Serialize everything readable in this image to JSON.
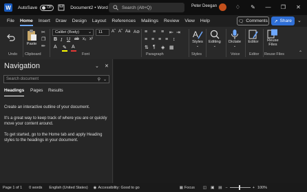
{
  "titlebar": {
    "app_letter": "W",
    "autosave_label": "AutoSave",
    "autosave_state": "Off",
    "doc_title": "Document2 • Word",
    "search_placeholder": "Search (Alt+Q)",
    "user_name": "Peter Deegan"
  },
  "tabs": [
    "File",
    "Home",
    "Insert",
    "Draw",
    "Design",
    "Layout",
    "References",
    "Mailings",
    "Review",
    "View",
    "Help"
  ],
  "active_tab": "Home",
  "comments_label": "Comments",
  "share_label": "Share",
  "ribbon": {
    "undo_label": "Undo",
    "clipboard": {
      "paste_label": "Paste",
      "group_label": "Clipboard"
    },
    "font": {
      "family": "Calibri (Body)",
      "size": "11",
      "group_label": "Font"
    },
    "paragraph_label": "Paragraph",
    "styles": {
      "button_label": "Styles",
      "group_label": "Styles"
    },
    "editing_label": "Editing",
    "voice": {
      "button_label": "Dictate",
      "group_label": "Voice"
    },
    "editor": {
      "button_label": "Editor",
      "group_label": "Editor"
    },
    "reuse": {
      "button_label_1": "Reuse",
      "button_label_2": "Files",
      "group_label": "Reuse Files"
    }
  },
  "navigation": {
    "title": "Navigation",
    "search_placeholder": "Search document",
    "tabs": [
      "Headings",
      "Pages",
      "Results"
    ],
    "paragraphs": [
      "Create an interactive outline of your document.",
      "It's a great way to keep track of where you are or quickly move your content around.",
      "To get started, go to the Home tab and apply Heading styles to the headings in your document."
    ]
  },
  "statusbar": {
    "page": "Page 1 of 1",
    "words": "0 words",
    "language": "English (United States)",
    "accessibility": "Accessibility: Good to go",
    "focus": "Focus",
    "zoom": "100%"
  },
  "colors": {
    "titlebar_bg": "#0f0f0f",
    "ribbon_bg": "#292929",
    "accent": "#2f6fd6",
    "word_blue": "#185abd",
    "avatar": "#c3501c"
  }
}
